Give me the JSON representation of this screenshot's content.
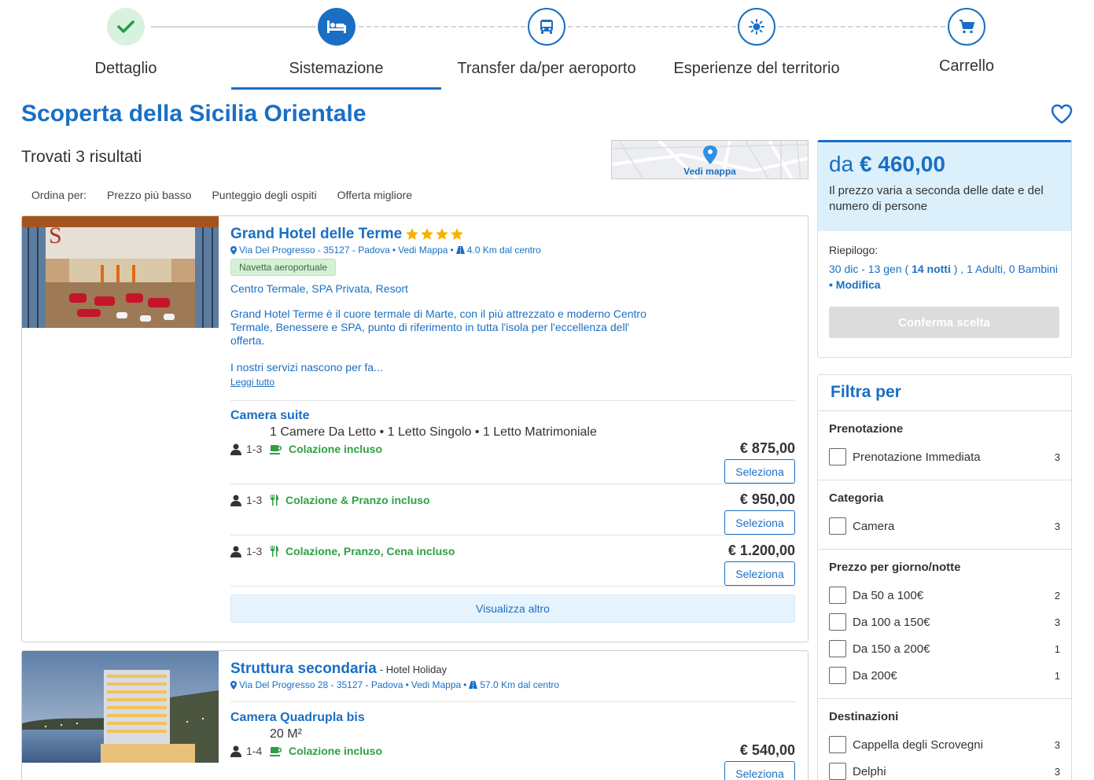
{
  "stepper": {
    "steps": [
      {
        "label": "Dettaglio",
        "state": "done",
        "icon": "check-icon"
      },
      {
        "label": "Sistemazione",
        "state": "active",
        "icon": "bed-icon"
      },
      {
        "label": "Transfer da/per aeroporto",
        "state": "todo",
        "icon": "bus-icon"
      },
      {
        "label": "Esperienze del territorio",
        "state": "todo",
        "icon": "sun-icon"
      },
      {
        "label": "Carrello",
        "state": "todo",
        "icon": "cart-icon"
      }
    ]
  },
  "page": {
    "title": "Scoperta della Sicilia Orientale",
    "results": "Trovati 3 risultati",
    "map_label": "Vedi mappa"
  },
  "sort": {
    "label": "Ordina per:",
    "options": [
      "Prezzo più basso",
      "Punteggio degli ospiti",
      "Offerta migliore"
    ]
  },
  "hotels": [
    {
      "name": "Grand Hotel delle Terme",
      "stars": 4,
      "address": "Via Del Progresso - 35127 - Padova",
      "map_link": "Vedi Mappa",
      "distance": "4.0 Km dal centro",
      "badge": "Navetta aeroportuale",
      "tags": "Centro Termale, SPA Privata, Resort",
      "description": "Grand Hotel Terme è il cuore termale di Marte, con il più attrezzato e moderno Centro Termale, Benessere e SPA, punto di riferimento in tutta l'isola per l'eccellenza dell' offerta.",
      "more": "I nostri servizi nascono per fa...",
      "read_all": "Leggi tutto",
      "room": {
        "name": "Camera suite",
        "desc": "1 Camere Da Letto • 1 Letto Singolo • 1 Letto Matrimoniale",
        "rates": [
          {
            "occupancy": "1-3",
            "board": "Colazione incluso",
            "board_icon": "coffee-icon",
            "price": "€ 875,00",
            "select": "Seleziona"
          },
          {
            "occupancy": "1-3",
            "board": "Colazione & Pranzo incluso",
            "board_icon": "fork-knife-icon",
            "price": "€ 950,00",
            "select": "Seleziona"
          },
          {
            "occupancy": "1-3",
            "board": "Colazione, Pranzo, Cena incluso",
            "board_icon": "fork-knife-icon",
            "price": "€ 1.200,00",
            "select": "Seleziona"
          }
        ]
      },
      "show_more": "Visualizza altro"
    },
    {
      "name": "Struttura secondaria",
      "subtitle": "- Hotel Holiday",
      "address": "Via Del Progresso 28 - 35127 - Padova",
      "map_link": "Vedi Mappa",
      "distance": "57.0 Km dal centro",
      "room": {
        "name": "Camera Quadrupla bis",
        "desc": "20 M²",
        "rates": [
          {
            "occupancy": "1-4",
            "board": "Colazione incluso",
            "board_icon": "coffee-icon",
            "price": "€ 540,00",
            "select": "Seleziona"
          }
        ]
      }
    }
  ],
  "summary": {
    "from": "da",
    "price": "€ 460,00",
    "note": "Il prezzo varia a seconda delle date e del numero di persone",
    "recap_label": "Riepilogo:",
    "dates": "30 dic - 13 gen (",
    "nights": "14 notti",
    "guests": ") , 1 Adulti, 0 Bambini",
    "edit": "• Modifica",
    "confirm": "Conferma scelta"
  },
  "filters": {
    "title": "Filtra per",
    "groups": [
      {
        "title": "Prenotazione",
        "options": [
          {
            "label": "Prenotazione Immediata",
            "count": "3"
          }
        ]
      },
      {
        "title": "Categoria",
        "options": [
          {
            "label": "Camera",
            "count": "3"
          }
        ]
      },
      {
        "title": "Prezzo per giorno/notte",
        "options": [
          {
            "label": "Da 50 a 100€",
            "count": "2"
          },
          {
            "label": "Da 100 a 150€",
            "count": "3"
          },
          {
            "label": "Da 150 a 200€",
            "count": "1"
          },
          {
            "label": "Da 200€",
            "count": "1"
          }
        ]
      },
      {
        "title": "Destinazioni",
        "options": [
          {
            "label": "Cappella degli Scrovegni",
            "count": "3"
          },
          {
            "label": "Delphi",
            "count": "3"
          }
        ]
      }
    ]
  },
  "colors": {
    "brand": "#1a6fc4",
    "green": "#2ea043",
    "star": "#f5b301"
  }
}
